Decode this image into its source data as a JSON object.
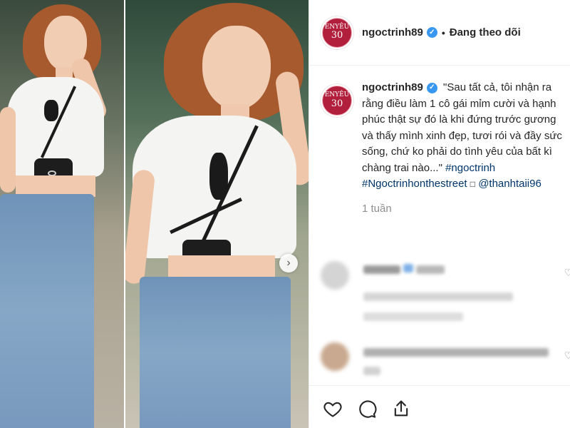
{
  "post": {
    "author": {
      "username": "ngoctrinh89",
      "verified": true,
      "avatar_text_top": "ENYÊU",
      "avatar_text_bottom": "30"
    },
    "header": {
      "separator": "•",
      "follow_status": "Đang theo dõi"
    },
    "caption": {
      "text": "\"Sau tất cả, tôi nhận ra rằng điều làm 1 cô gái mỉm cười và hạnh phúc thật sự đó là khi đứng trước gương và thấy mình xinh đẹp, tươi rói và đầy sức sống, chứ ko phải do tình yêu của bất kì chàng trai nào...\"",
      "hashtag_1": "#ngoctrinh",
      "hashtag_2": "#Ngoctrinhonthestreet",
      "mention": "@thanhtaii96",
      "time": "1 tuần"
    },
    "colors": {
      "accent_blue": "#3897f0",
      "link": "#003569",
      "avatar_bg": "#b11f3c",
      "muted": "#8e8e8e"
    },
    "icons": {
      "verified": "verified-badge-icon",
      "carousel_next": "chevron-right-icon",
      "like": "heart-icon",
      "comment": "comment-bubble-icon",
      "share": "share-icon"
    }
  }
}
